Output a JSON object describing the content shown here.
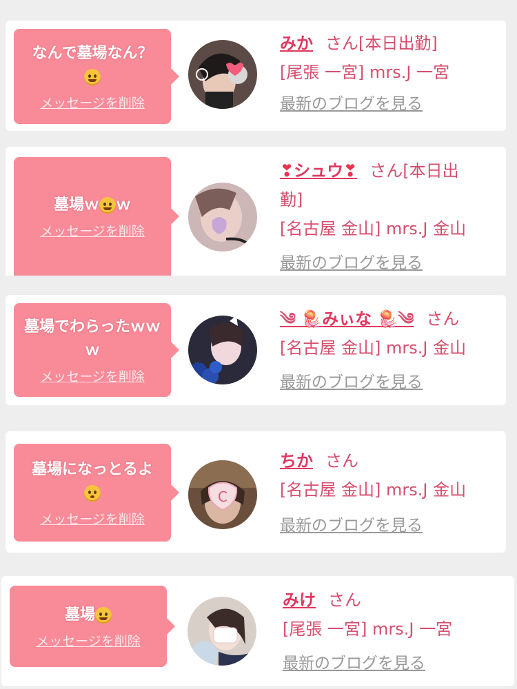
{
  "messages": [
    {
      "text": "なんで墓場なん？",
      "emoji": "star-struck-emoji",
      "delete_label": "メッセージを削除",
      "name": "みか",
      "san": "さん",
      "status": "[本日出勤]",
      "shop": "[尾張 一宮] mrs.J 一宮",
      "blog_label": "最新のブログを見る"
    },
    {
      "text": "墓場ｗ",
      "emoji": "rofl-emoji",
      "tail": "ｗ",
      "delete_label": "メッセージを削除",
      "name_prefix": "❣",
      "name": "シュウ",
      "name_suffix": "❣",
      "san": "さん",
      "status": "[本日出",
      "status_cont": "勤]",
      "shop": "[名古屋 金山] mrs.J 金山",
      "blog_label": "最新のブログを見る"
    },
    {
      "text": "墓場でわらったｗｗｗ",
      "delete_label": "メッセージを削除",
      "name_prefix": "༄",
      "jelly": "🪼",
      "name": "みぃな",
      "name_suffix": "༄",
      "san": "さん",
      "shop": "[名古屋 金山] mrs.J 金山",
      "blog_label": "最新のブログを見る"
    },
    {
      "text": "墓場になっとるよ",
      "emoji": "flushed-emoji",
      "delete_label": "メッセージを削除",
      "name": "ちか",
      "san": "さん",
      "shop": "[名古屋 金山] mrs.J 金山",
      "blog_label": "最新のブログを見る"
    },
    {
      "text": "墓場",
      "emoji": "rofl-emoji",
      "delete_label": "メッセージを削除",
      "name": "みけ",
      "san": "さん",
      "shop": "[尾張 一宮] mrs.J 一宮",
      "blog_label": "最新のブログを見る"
    }
  ],
  "colors": {
    "bubble": "#f98a98",
    "name": "#e0385f",
    "text": "#d64e6e",
    "link_gray": "#999999",
    "background": "#eeeeee"
  }
}
